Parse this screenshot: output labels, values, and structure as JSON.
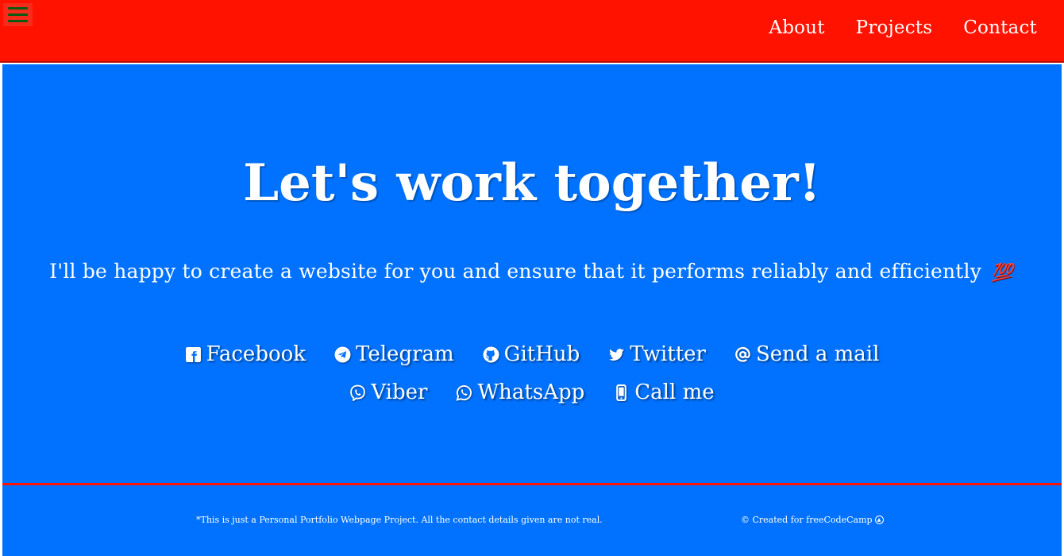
{
  "nav": {
    "menu_icon": "hamburger-menu-icon",
    "links": [
      "About",
      "Projects",
      "Contact"
    ]
  },
  "hero": {
    "title": "Let's work together!",
    "subtitle": "I'll be happy to create a website for you and ensure that it performs reliably and efficiently",
    "emoji": "💯"
  },
  "contacts": {
    "row1": [
      {
        "label": "Facebook",
        "icon": "facebook-icon"
      },
      {
        "label": "Telegram",
        "icon": "telegram-icon"
      },
      {
        "label": "GitHub",
        "icon": "github-icon"
      },
      {
        "label": "Twitter",
        "icon": "twitter-icon"
      },
      {
        "label": "Send a mail",
        "icon": "at-sign-icon"
      }
    ],
    "row2": [
      {
        "label": "Viber",
        "icon": "viber-icon"
      },
      {
        "label": "WhatsApp",
        "icon": "whatsapp-icon"
      },
      {
        "label": "Call me",
        "icon": "mobile-phone-icon"
      }
    ]
  },
  "footer": {
    "note": "*This is just a Personal Portfolio Webpage Project. All the contact details given are not real.",
    "credit": "© Created for freeCodeCamp",
    "credit_icon": "up-arrow-circle-icon"
  },
  "colors": {
    "navbar": "#ff1200",
    "hero_bg": "#0072ff",
    "text": "#ffffff",
    "menu_icon": "#0d5b10"
  }
}
